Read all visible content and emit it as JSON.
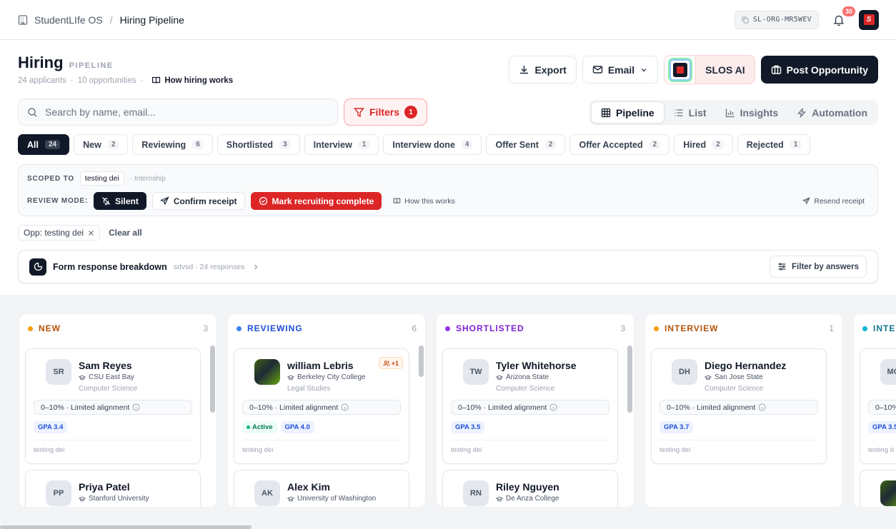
{
  "topbar": {
    "org": "StudentLIfe OS",
    "page": "Hiring Pipeline",
    "org_id": "SL-ORG-MR5WEV",
    "notifications": "30"
  },
  "header": {
    "title": "Hiring",
    "tag": "PIPELINE",
    "applicants": "24 applicants",
    "opportunities": "10 opportunities",
    "how_link": "How hiring works"
  },
  "actions": {
    "export": "Export",
    "email": "Email",
    "ai": "SLOS AI",
    "post": "Post Opportunity"
  },
  "search": {
    "placeholder": "Search by name, email..."
  },
  "filters": {
    "label": "Filters",
    "count": "1"
  },
  "views": [
    "Pipeline",
    "List",
    "Insights",
    "Automation"
  ],
  "tabs": [
    {
      "label": "All",
      "count": "24"
    },
    {
      "label": "New",
      "count": "2"
    },
    {
      "label": "Reviewing",
      "count": "6"
    },
    {
      "label": "Shortlisted",
      "count": "3"
    },
    {
      "label": "Interview",
      "count": "1"
    },
    {
      "label": "Interview done",
      "count": "4"
    },
    {
      "label": "Offer Sent",
      "count": "2"
    },
    {
      "label": "Offer Accepted",
      "count": "2"
    },
    {
      "label": "Hired",
      "count": "2"
    },
    {
      "label": "Rejected",
      "count": "1"
    }
  ],
  "scope": {
    "scoped_label": "SCOPED TO",
    "scope_value": "testing dei",
    "scope_type": "· Internship",
    "review_label": "REVIEW MODE:",
    "silent": "Silent",
    "confirm": "Confirm receipt",
    "complete": "Mark recruiting complete",
    "how": "How this works",
    "resend": "Resend receipt"
  },
  "active_filters": {
    "chip": "Opp: testing dei",
    "clear": "Clear all"
  },
  "form_card": {
    "title": "Form response breakdown",
    "sub": "sdvsd · 24 responses",
    "filter_btn": "Filter by answers"
  },
  "columns": [
    {
      "name": "NEW",
      "count": "3",
      "color": "#f59e0b",
      "cards": [
        {
          "initials": "SR",
          "name": "Sam Reyes",
          "school": "CSU East Bay",
          "major": "Computer Science",
          "align": "0–10% · Limited alignment",
          "gpa": "GPA 3.4",
          "opp": "testing dei"
        },
        {
          "initials": "PP",
          "name": "Priya Patel",
          "school": "Stanford University"
        }
      ]
    },
    {
      "name": "REVIEWING",
      "count": "6",
      "color": "#3b82f6",
      "cards": [
        {
          "initials": "",
          "name": "william Lebris",
          "school": "Berkeley City College",
          "major": "Legal Studies",
          "align": "0–10% · Limited alignment",
          "status": "Active",
          "gpa": "GPA 4.0",
          "opp": "testing dei",
          "more": "+1"
        },
        {
          "initials": "AK",
          "name": "Alex Kim",
          "school": "University of Washington"
        }
      ]
    },
    {
      "name": "SHORTLISTED",
      "count": "3",
      "color": "#9333ea",
      "cards": [
        {
          "initials": "TW",
          "name": "Tyler Whitehorse",
          "school": "Arizona State",
          "major": "Computer Science",
          "align": "0–10% · Limited alignment",
          "gpa": "GPA 3.5",
          "opp": "testing dei"
        },
        {
          "initials": "RN",
          "name": "Riley Nguyen",
          "school": "De Anza College"
        }
      ]
    },
    {
      "name": "INTERVIEW",
      "count": "1",
      "color": "#f59e0b",
      "cards": [
        {
          "initials": "DH",
          "name": "Diego Hernandez",
          "school": "San Jose State",
          "major": "Computer Science",
          "align": "0–10% · Limited alignment",
          "gpa": "GPA 3.7",
          "opp": "testing dei"
        }
      ]
    },
    {
      "name": "INTE",
      "color": "#06b6d4",
      "cards": [
        {
          "initials": "MC",
          "align": "0–10%",
          "gpa": "GPA 3.5",
          "opp": "testing d"
        }
      ]
    }
  ]
}
